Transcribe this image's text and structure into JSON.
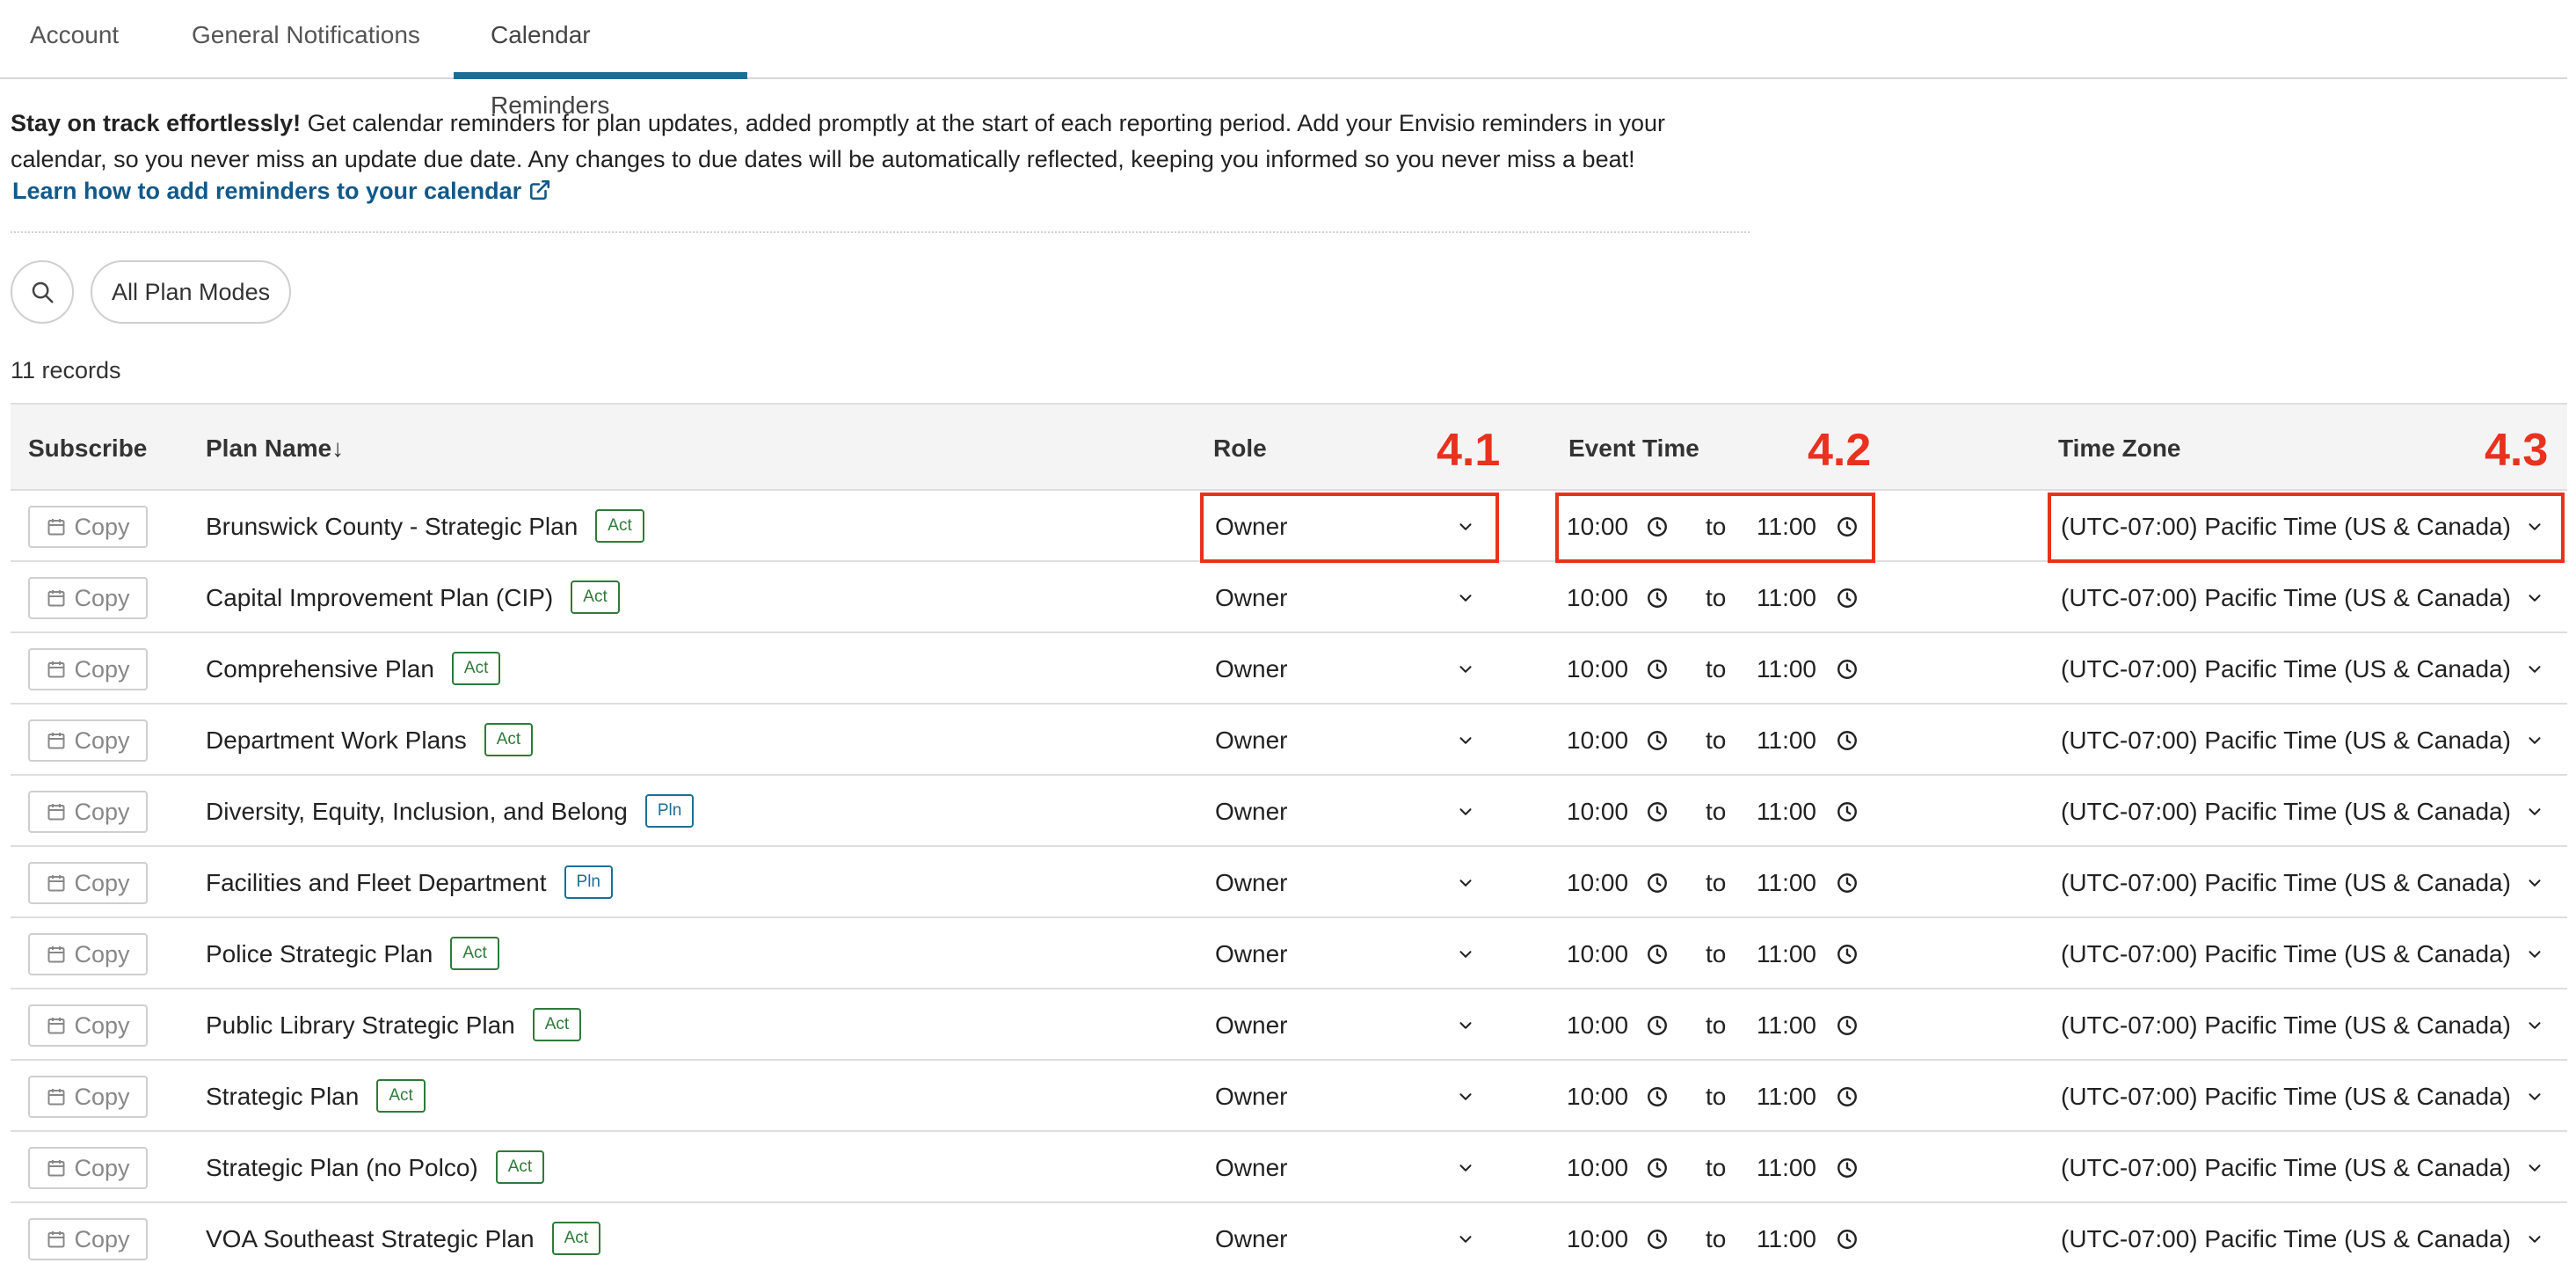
{
  "tabs": [
    {
      "label": "Account",
      "active": false
    },
    {
      "label": "General Notifications",
      "active": false
    },
    {
      "label": "Calendar Reminders",
      "active": true
    }
  ],
  "intro": {
    "bold": "Stay on track effortlessly!",
    "text": " Get calendar reminders for plan updates, added promptly at the start of each reporting period. Add your Envisio reminders in your calendar, so you never miss an update due date. Any changes to due dates will be automatically reflected, keeping you informed so you never miss a beat!",
    "link": "Learn how to add reminders to your calendar"
  },
  "filters": {
    "search_icon": "search-icon",
    "plan_modes": "All Plan Modes"
  },
  "records": "11 records",
  "columns": {
    "subscribe": "Subscribe",
    "plan_name": "Plan Name↓",
    "role": "Role",
    "event_time": "Event Time",
    "time_zone": "Time Zone"
  },
  "annotations": [
    "4.1",
    "4.2",
    "4.3"
  ],
  "colors": {
    "accent": "#1b6f96",
    "link": "#11598a",
    "annotation": "#e8321e",
    "badge_act": "#2f7a3a",
    "badge_pln": "#1b6f96"
  },
  "copy_label": "Copy",
  "to_label": "to",
  "rows": [
    {
      "plan": "Brunswick County - Strategic Plan",
      "badge": "Act",
      "role": "Owner",
      "start": "10:00",
      "end": "11:00",
      "tz": "(UTC-07:00) Pacific Time (US & Canada)"
    },
    {
      "plan": "Capital Improvement Plan (CIP)",
      "badge": "Act",
      "role": "Owner",
      "start": "10:00",
      "end": "11:00",
      "tz": "(UTC-07:00) Pacific Time (US & Canada)"
    },
    {
      "plan": "Comprehensive Plan",
      "badge": "Act",
      "role": "Owner",
      "start": "10:00",
      "end": "11:00",
      "tz": "(UTC-07:00) Pacific Time (US & Canada)"
    },
    {
      "plan": "Department Work Plans",
      "badge": "Act",
      "role": "Owner",
      "start": "10:00",
      "end": "11:00",
      "tz": "(UTC-07:00) Pacific Time (US & Canada)"
    },
    {
      "plan": "Diversity, Equity, Inclusion, and Belong",
      "badge": "Pln",
      "role": "Owner",
      "start": "10:00",
      "end": "11:00",
      "tz": "(UTC-07:00) Pacific Time (US & Canada)"
    },
    {
      "plan": "Facilities and Fleet Department",
      "badge": "Pln",
      "role": "Owner",
      "start": "10:00",
      "end": "11:00",
      "tz": "(UTC-07:00) Pacific Time (US & Canada)"
    },
    {
      "plan": "Police Strategic Plan",
      "badge": "Act",
      "role": "Owner",
      "start": "10:00",
      "end": "11:00",
      "tz": "(UTC-07:00) Pacific Time (US & Canada)"
    },
    {
      "plan": "Public Library Strategic Plan",
      "badge": "Act",
      "role": "Owner",
      "start": "10:00",
      "end": "11:00",
      "tz": "(UTC-07:00) Pacific Time (US & Canada)"
    },
    {
      "plan": "Strategic Plan",
      "badge": "Act",
      "role": "Owner",
      "start": "10:00",
      "end": "11:00",
      "tz": "(UTC-07:00) Pacific Time (US & Canada)"
    },
    {
      "plan": "Strategic Plan (no Polco)",
      "badge": "Act",
      "role": "Owner",
      "start": "10:00",
      "end": "11:00",
      "tz": "(UTC-07:00) Pacific Time (US & Canada)"
    },
    {
      "plan": "VOA Southeast Strategic Plan",
      "badge": "Act",
      "role": "Owner",
      "start": "10:00",
      "end": "11:00",
      "tz": "(UTC-07:00) Pacific Time (US & Canada)"
    }
  ]
}
